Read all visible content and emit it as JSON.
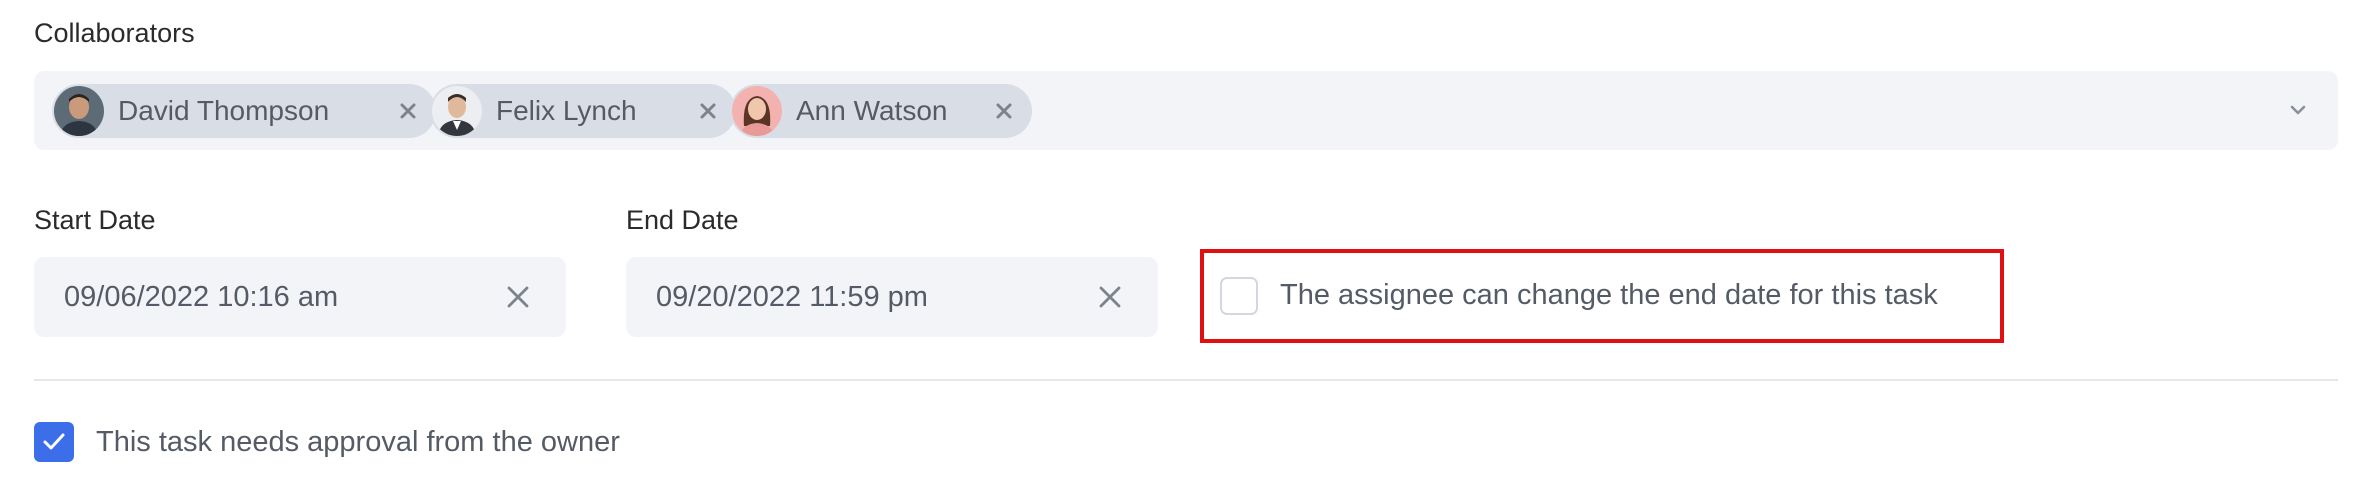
{
  "collaborators": {
    "label": "Collaborators",
    "chips": [
      {
        "name": "David Thompson"
      },
      {
        "name": "Felix Lynch"
      },
      {
        "name": "Ann Watson"
      }
    ]
  },
  "dates": {
    "start_label": "Start Date",
    "start_value": "09/06/2022 10:16 am",
    "end_label": "End Date",
    "end_value": "09/20/2022 11:59 pm"
  },
  "assignee_option": {
    "label": "The assignee can change the end date for this task",
    "checked": false,
    "highlight_color": "#e01010"
  },
  "approval_option": {
    "label": "This task needs approval from the owner",
    "checked": true,
    "color": "#3b6ee8"
  },
  "icons": {
    "chip_remove": "close-icon",
    "dropdown": "chevron-down-icon",
    "date_clear": "close-icon",
    "check": "checkmark-icon"
  }
}
